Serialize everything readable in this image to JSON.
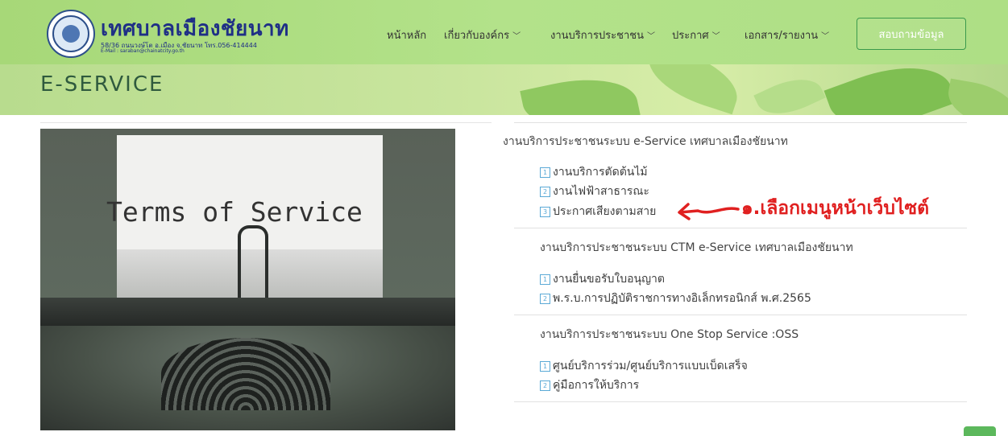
{
  "header": {
    "site_title": "เทศบาลเมืองชัยนาท",
    "address": "58/36 ถนนวงษ์โต อ.เมือง จ.ชัยนาท โทร.056-414444",
    "email": "E-Mail : saraban@chainatcity.go.th",
    "nav": [
      {
        "label": "หน้าหลัก",
        "dropdown": false
      },
      {
        "label": "เกี่ยวกับองค์กร",
        "dropdown": true
      },
      {
        "label": "งานบริการประชาชน",
        "dropdown": true
      },
      {
        "label": "ประกาศ",
        "dropdown": true
      },
      {
        "label": "เอกสาร/รายงาน",
        "dropdown": true
      }
    ],
    "contact_button": "สอบถามข้อมูล",
    "chevron_glyph": "﹀"
  },
  "banner": {
    "title": "E-SERVICE"
  },
  "image": {
    "text": "Terms of Service"
  },
  "sections": [
    {
      "title": "งานบริการประชาชนระบบ e-Service เทศบาลเมืองชัยนาท",
      "items": [
        {
          "num": "1",
          "label": "งานบริการตัดต้นไม้"
        },
        {
          "num": "2",
          "label": "งานไฟฟ้าสาธารณะ"
        },
        {
          "num": "3",
          "label": "ประกาศเสียงตามสาย"
        }
      ]
    },
    {
      "title": "งานบริการประชาชนระบบ CTM e-Service เทศบาลเมืองชัยนาท",
      "items": [
        {
          "num": "1",
          "label": "งานยื่นขอรับใบอนุญาต"
        },
        {
          "num": "2",
          "label": "พ.ร.บ.การปฏิบัติราชการทางอิเล็กทรอนิกส์ พ.ศ.2565"
        }
      ]
    },
    {
      "title": "งานบริการประชาชนระบบ One Stop Service :OSS",
      "items": [
        {
          "num": "1",
          "label": "ศูนย์บริการร่วม/ศูนย์บริการแบบเบ็ดเสร็จ"
        },
        {
          "num": "2",
          "label": "คู่มือการให้บริการ"
        }
      ]
    }
  ],
  "annotation": {
    "text": "๑.เลือกเมนูหน้าเว็บไซต์",
    "color": "#e02020"
  },
  "colors": {
    "header_green": "#b3e28a",
    "brand_blue": "#1f2f86",
    "number_blue": "#5aa9d6"
  }
}
